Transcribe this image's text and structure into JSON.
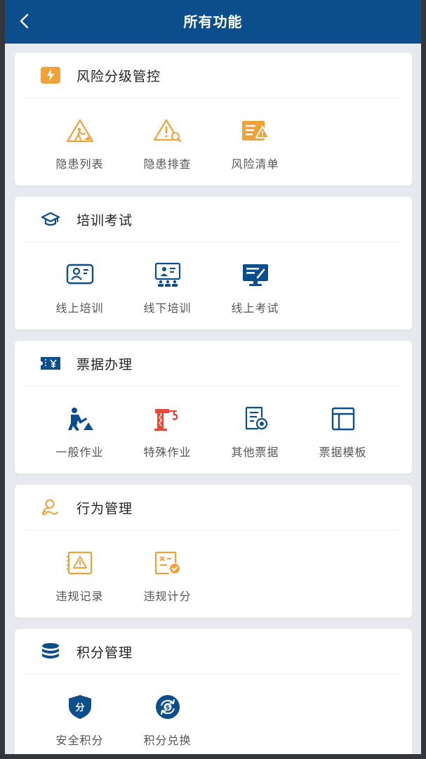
{
  "header": {
    "title": "所有功能",
    "back_icon": "chevron-left-icon"
  },
  "colors": {
    "primary": "#0c4d8c",
    "accent_orange": "#f0a23a",
    "accent_red": "#e34c3d"
  },
  "sections": [
    {
      "title": "风险分级管控",
      "icon": "lightning-icon",
      "items": [
        {
          "label": "隐患列表",
          "icon": "warning-construction-icon"
        },
        {
          "label": "隐患排查",
          "icon": "warning-search-icon"
        },
        {
          "label": "风险清单",
          "icon": "list-warning-icon"
        }
      ]
    },
    {
      "title": "培训考试",
      "icon": "graduation-cap-icon",
      "items": [
        {
          "label": "线上培训",
          "icon": "online-training-icon"
        },
        {
          "label": "线下培训",
          "icon": "classroom-icon"
        },
        {
          "label": "线上考试",
          "icon": "exam-monitor-icon"
        }
      ]
    },
    {
      "title": "票据办理",
      "icon": "ticket-yuan-icon",
      "items": [
        {
          "label": "一般作业",
          "icon": "worker-icon"
        },
        {
          "label": "特殊作业",
          "icon": "crane-icon"
        },
        {
          "label": "其他票据",
          "icon": "document-stamp-icon"
        },
        {
          "label": "票据模板",
          "icon": "template-icon"
        }
      ]
    },
    {
      "title": "行为管理",
      "icon": "person-behavior-icon",
      "items": [
        {
          "label": "违规记录",
          "icon": "violation-record-icon"
        },
        {
          "label": "违规计分",
          "icon": "violation-score-icon"
        }
      ]
    },
    {
      "title": "积分管理",
      "icon": "database-icon",
      "items": [
        {
          "label": "安全积分",
          "icon": "shield-points-icon",
          "glyph": "分"
        },
        {
          "label": "积分兑换",
          "icon": "exchange-icon"
        }
      ]
    }
  ]
}
